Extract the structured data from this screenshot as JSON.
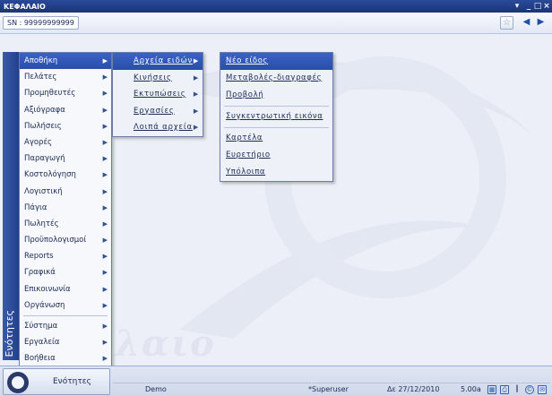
{
  "window": {
    "title": "ΚΕΦΑΛΑΙΟ"
  },
  "toolbar": {
    "sn_label": "SN : 99999999999"
  },
  "sidebar": {
    "label": "Ενότητες"
  },
  "watermark": "λαιο",
  "menu1": {
    "items": [
      {
        "label": "Αποθήκη"
      },
      {
        "label": "Πελάτες"
      },
      {
        "label": "Προμηθευτές"
      },
      {
        "label": "Αξιόγραφα"
      },
      {
        "label": "Πωλήσεις"
      },
      {
        "label": "Αγορές"
      },
      {
        "label": "Παραγωγή"
      },
      {
        "label": "Κοστολόγηση"
      },
      {
        "label": "Λογιστική"
      },
      {
        "label": "Πάγια"
      },
      {
        "label": "Πωλητές"
      },
      {
        "label": "Προϋπολογισμοί"
      },
      {
        "label": "Reports"
      },
      {
        "label": "Γραφικά"
      },
      {
        "label": "Επικοινωνία"
      },
      {
        "label": "Οργάνωση"
      },
      {
        "label": "Σύστημα"
      },
      {
        "label": "Εργαλεία"
      },
      {
        "label": "Βοήθεια"
      }
    ]
  },
  "menu2": {
    "items": [
      {
        "label": "Αρχεία ειδών"
      },
      {
        "label": "Κινήσεις"
      },
      {
        "label": "Εκτυπώσεις"
      },
      {
        "label": "Εργασίες"
      },
      {
        "label": "Λοιπά αρχεία"
      }
    ]
  },
  "menu3": {
    "items": [
      {
        "label": "Νέο είδος"
      },
      {
        "label": "Μεταβολές-διαγραφές"
      },
      {
        "label": "Προβολή"
      },
      {
        "label": "Συγκεντρωτική εικόνα"
      },
      {
        "label": "Καρτέλα"
      },
      {
        "label": "Ευρετήριο"
      },
      {
        "label": "Υπόλοιπα"
      }
    ]
  },
  "statusbar": {
    "start_label": "Ενότητες",
    "company": "Demo",
    "user": "*Superuser",
    "date": "Δε 27/12/2010",
    "version": "5.00a"
  },
  "colors": {
    "accent": "#2a4ea8",
    "title_bar": "#1c3478"
  }
}
